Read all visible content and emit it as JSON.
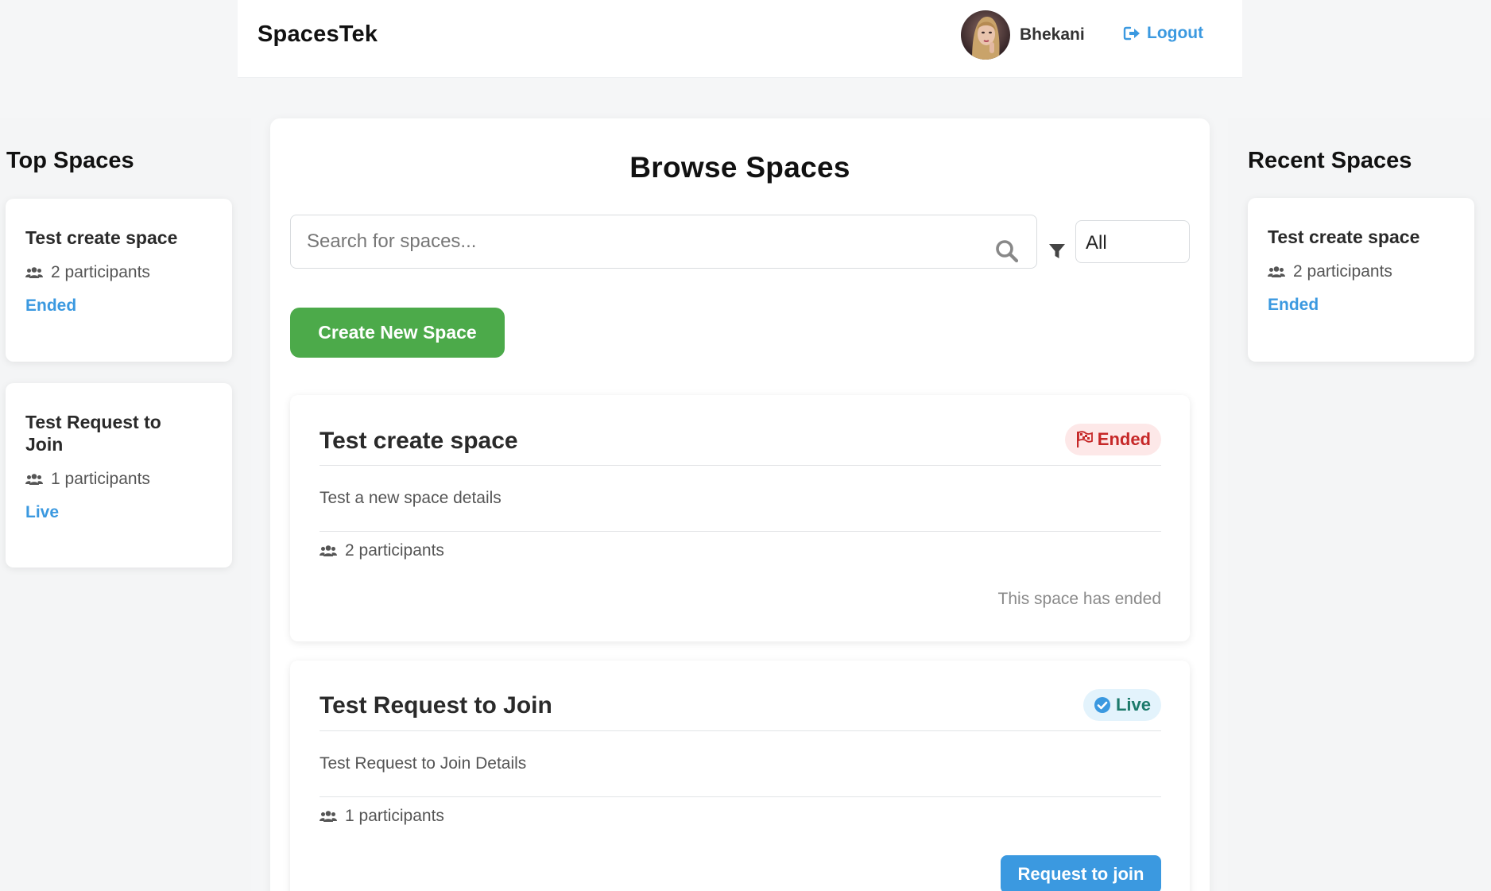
{
  "header": {
    "brand": "SpacesTek",
    "user_name": "Bhekani",
    "logout_label": "Logout"
  },
  "top_spaces": {
    "title": "Top Spaces",
    "items": [
      {
        "title": "Test create space",
        "participants": "2 participants",
        "status": "Ended"
      },
      {
        "title": "Test Request to Join",
        "participants": "1 participants",
        "status": "Live"
      }
    ]
  },
  "recent_spaces": {
    "title": "Recent Spaces",
    "items": [
      {
        "title": "Test create space",
        "participants": "2 participants",
        "status": "Ended"
      }
    ]
  },
  "main": {
    "title": "Browse Spaces",
    "search_placeholder": "Search for spaces...",
    "filter_value": "All",
    "create_label": "Create New Space",
    "spaces": [
      {
        "title": "Test create space",
        "badge": "Ended",
        "description": "Test a new space details",
        "participants": "2 participants",
        "note": "This space has ended"
      },
      {
        "title": "Test Request to Join",
        "badge": "Live",
        "description": "Test Request to Join Details",
        "participants": "1 participants",
        "action_label": "Request to join"
      }
    ]
  },
  "colors": {
    "accent_blue": "#3b99e0",
    "create_green": "#4caa4a",
    "ended_red": "#c62828",
    "live_teal": "#1c7a6b"
  },
  "icons": {
    "logout": "sign-out-icon",
    "participants": "users-icon",
    "search": "search-icon",
    "filter": "filter-icon",
    "ended_badge": "flag-checkered-icon",
    "live_badge": "check-circle-icon"
  }
}
